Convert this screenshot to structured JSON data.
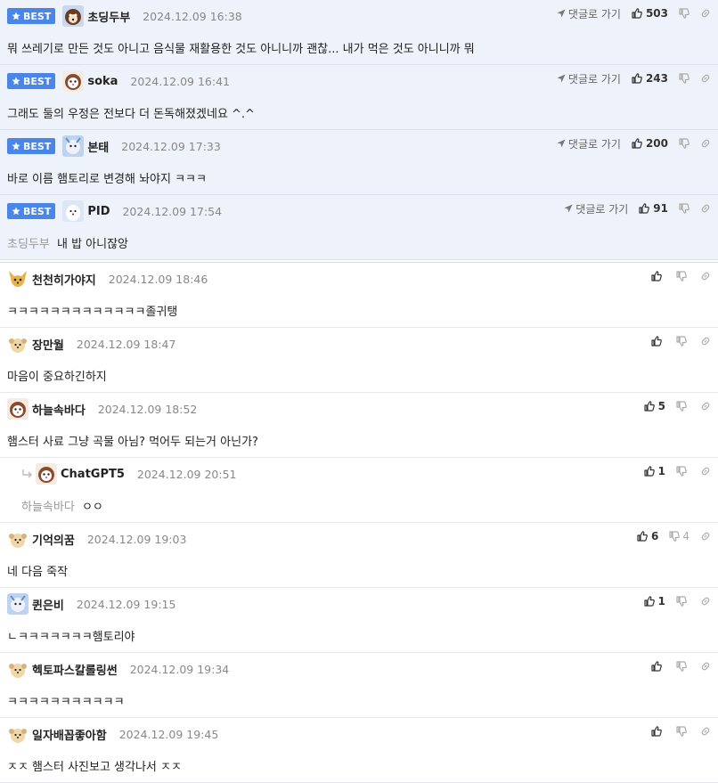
{
  "best_label": "BEST",
  "goto_label": "댓글로 가기",
  "best_comments": [
    {
      "nick": "초딩두부",
      "date": "2024.12.09 16:38",
      "likes": "503",
      "text": "뭐 쓰레기로 만든 것도 아니고 음식물 재활용한 것도 아니니까 괜찮... 내가 먹은 것도 아니니까 뭐",
      "mention": ""
    },
    {
      "nick": "soka",
      "date": "2024.12.09 16:41",
      "likes": "243",
      "text": "그래도 둘의 우정은 전보다 더 돈독해졌겠네요 ^.^",
      "mention": ""
    },
    {
      "nick": "본태",
      "date": "2024.12.09 17:33",
      "likes": "200",
      "text": "바로 이름 햄토리로 변경해 놔야지 ㅋㅋㅋ",
      "mention": ""
    },
    {
      "nick": "PID",
      "date": "2024.12.09 17:54",
      "likes": "91",
      "text": "내 밥 아니잖앙",
      "mention": "초딩두부"
    }
  ],
  "comments": [
    {
      "nick": "천천히가야지",
      "date": "2024.12.09 18:46",
      "likes": "",
      "dislikes": "",
      "text": "ㅋㅋㅋㅋㅋㅋㅋㅋㅋㅋㅋㅋㅋ졸귀탱",
      "mention": ""
    },
    {
      "nick": "장만월",
      "date": "2024.12.09 18:47",
      "likes": "",
      "dislikes": "",
      "text": "마음이 중요하긴하지",
      "mention": ""
    },
    {
      "nick": "하늘속바다",
      "date": "2024.12.09 18:52",
      "likes": "5",
      "dislikes": "",
      "text": "햄스터 사료 그냥 곡물 아님? 먹어두 되는거 아닌가?",
      "mention": ""
    },
    {
      "nick": "ChatGPT5",
      "date": "2024.12.09 20:51",
      "likes": "1",
      "dislikes": "",
      "text": "ㅇㅇ",
      "mention": "하늘속바다"
    },
    {
      "nick": "기억의꿈",
      "date": "2024.12.09 19:03",
      "likes": "6",
      "dislikes": "4",
      "text": "네 다음 죽작",
      "mention": ""
    },
    {
      "nick": "퀸은비",
      "date": "2024.12.09 19:15",
      "likes": "1",
      "dislikes": "",
      "text": "ㄴㅋㅋㅋㅋㅋㅋㅋ햄토리야",
      "mention": ""
    },
    {
      "nick": "헥토파스칼롤링썬",
      "date": "2024.12.09 19:34",
      "likes": "",
      "dislikes": "",
      "text": "ㅋㅋㅋㅋㅋㅋㅋㅋㅋㅋㅋ",
      "mention": ""
    },
    {
      "nick": "일자배꼽좋아함",
      "date": "2024.12.09 19:45",
      "likes": "",
      "dislikes": "",
      "text": "ㅈㅈ 햄스터 사진보고 생각나서 ㅈㅈ",
      "mention": ""
    }
  ],
  "icons": {
    "star": "star-icon",
    "goto": "location-arrow-icon",
    "thumb_up": "thumbs-up-icon",
    "thumb_down": "thumbs-down-icon",
    "link": "link-icon",
    "reply": "reply-arrow-icon"
  },
  "colors": {
    "best_badge": "#4a86e8",
    "best_bg": "#eef3fb",
    "date": "#888888",
    "mention": "#999999"
  }
}
